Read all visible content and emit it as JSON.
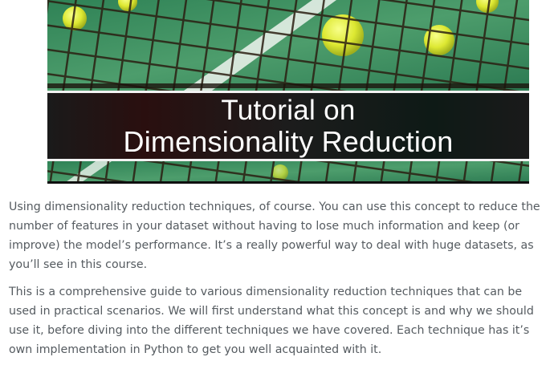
{
  "hero": {
    "title_line1": "Tutorial on",
    "title_line2": "Dimensionality Reduction"
  },
  "body": {
    "paragraph1": "Using dimensionality reduction techniques, of course. You can use this concept to reduce the number of features in your dataset without having to lose much information and keep (or improve) the model’s performance. It’s a really powerful way to deal with huge datasets, as you’ll see in this course.",
    "paragraph2": "This is a comprehensive guide to various dimensionality reduction techniques that can be used in practical scenarios. We will first understand what this concept is and why we should use it, before diving into the  different techniques we have covered. Each technique has it’s own implementation in Python to get you well acquainted with it."
  },
  "colors": {
    "body_text": "#555b60",
    "court_green": "#3a8a5a",
    "ball_yellow": "#e8ee3a"
  }
}
